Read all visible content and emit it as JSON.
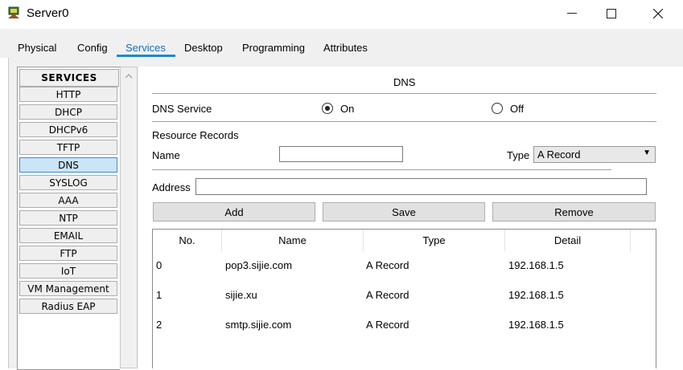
{
  "window": {
    "title": "Server0",
    "minimize": "—",
    "maximize": "☐",
    "close": "✕"
  },
  "tabs": [
    {
      "label": "Physical"
    },
    {
      "label": "Config"
    },
    {
      "label": "Services"
    },
    {
      "label": "Desktop"
    },
    {
      "label": "Programming"
    },
    {
      "label": "Attributes"
    }
  ],
  "sidebar": {
    "header": "SERVICES",
    "items": [
      "HTTP",
      "DHCP",
      "DHCPv6",
      "TFTP",
      "DNS",
      "SYSLOG",
      "AAA",
      "NTP",
      "EMAIL",
      "FTP",
      "IoT",
      "VM Management",
      "Radius EAP"
    ],
    "selected": "DNS"
  },
  "dns": {
    "title": "DNS",
    "service_label": "DNS Service",
    "on_label": "On",
    "off_label": "Off",
    "service_state": "On",
    "resource_records_label": "Resource Records",
    "name_label": "Name",
    "name_value": "",
    "type_label": "Type",
    "type_value": "A Record",
    "address_label": "Address",
    "address_value": "",
    "buttons": {
      "add": "Add",
      "save": "Save",
      "remove": "Remove"
    },
    "table": {
      "columns": [
        "No.",
        "Name",
        "Type",
        "Detail"
      ],
      "rows": [
        [
          "0",
          "pop3.sijie.com",
          "A Record",
          "192.168.1.5"
        ],
        [
          "1",
          "sijie.xu",
          "A Record",
          "192.168.1.5"
        ],
        [
          "2",
          "smtp.sijie.com",
          "A Record",
          "192.168.1.5"
        ]
      ]
    }
  }
}
